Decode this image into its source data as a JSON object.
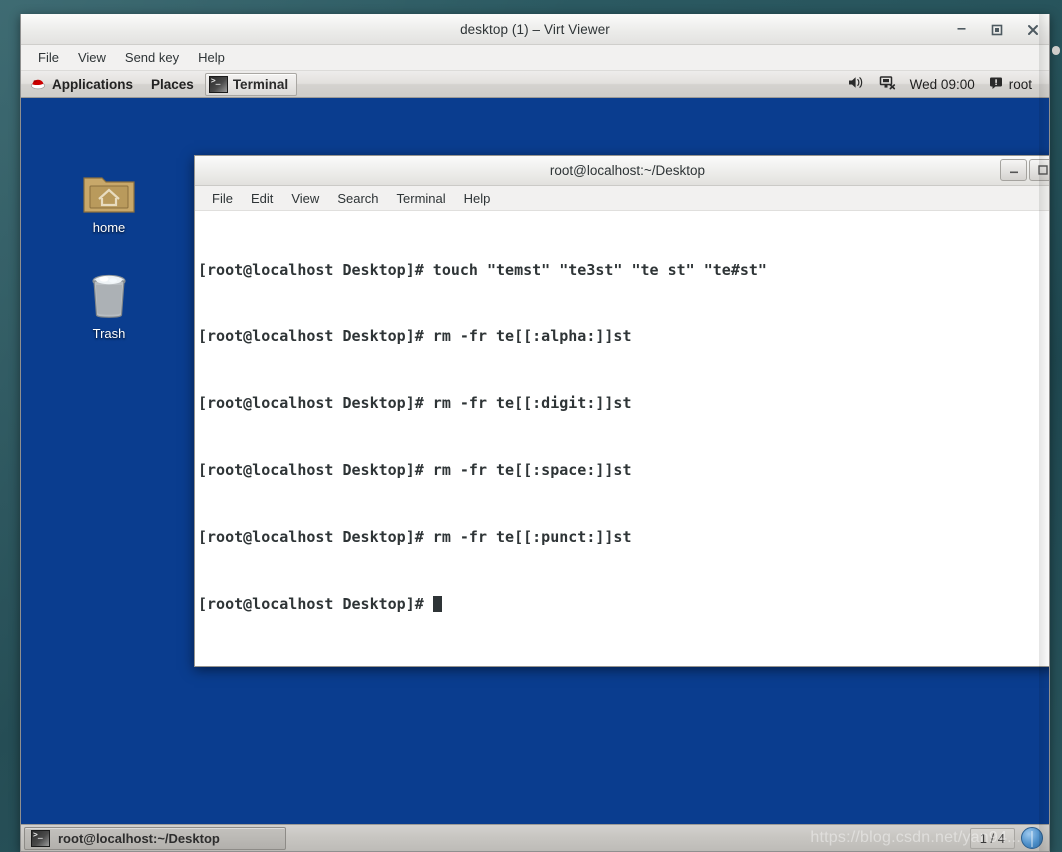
{
  "virt_viewer": {
    "title": "desktop (1) – Virt Viewer",
    "window_controls": {
      "minimize": "minimize-icon",
      "maximize": "maximize-icon",
      "close": "close-icon"
    },
    "menu": [
      "File",
      "View",
      "Send key",
      "Help"
    ]
  },
  "guest": {
    "panel": {
      "applications": "Applications",
      "places": "Places",
      "window_task": "Terminal",
      "tray": {
        "volume_icon": "volume-icon",
        "network_icon": "network-disconnected-icon",
        "clock": "Wed 09:00",
        "user_icon": "messages-icon",
        "user": "root"
      }
    },
    "desktop_icons": [
      {
        "label": "home",
        "icon": "home-folder-icon"
      },
      {
        "label": "Trash",
        "icon": "trash-icon"
      }
    ],
    "terminal": {
      "title": "root@localhost:~/Desktop",
      "menu": [
        "File",
        "Edit",
        "View",
        "Search",
        "Terminal",
        "Help"
      ],
      "window_controls": {
        "minimize": "minimize-icon",
        "maximize": "maximize-icon"
      },
      "lines": [
        "[root@localhost Desktop]# touch \"temst\" \"te3st\" \"te st\" \"te#st\"",
        "[root@localhost Desktop]# rm -fr te[[:alpha:]]st",
        "[root@localhost Desktop]# rm -fr te[[:digit:]]st",
        "[root@localhost Desktop]# rm -fr te[[:space:]]st",
        "[root@localhost Desktop]# rm -fr te[[:punct:]]st"
      ],
      "prompt": "[root@localhost Desktop]# "
    },
    "taskbar": {
      "window_button": "root@localhost:~/Desktop",
      "window_button_icon": "terminal-icon",
      "page_indicator": "1 / 4",
      "show_desktop_icon": "show-desktop-icon"
    }
  },
  "watermark": "https://blog.csdn.net/yan94...",
  "colors": {
    "desktop_blue": "#0a3d8f",
    "panel_grey": "#d4d2cf",
    "terminal_bg": "#ffffff",
    "terminal_fg": "#2e3436",
    "host_bg": "#2c5a63"
  }
}
